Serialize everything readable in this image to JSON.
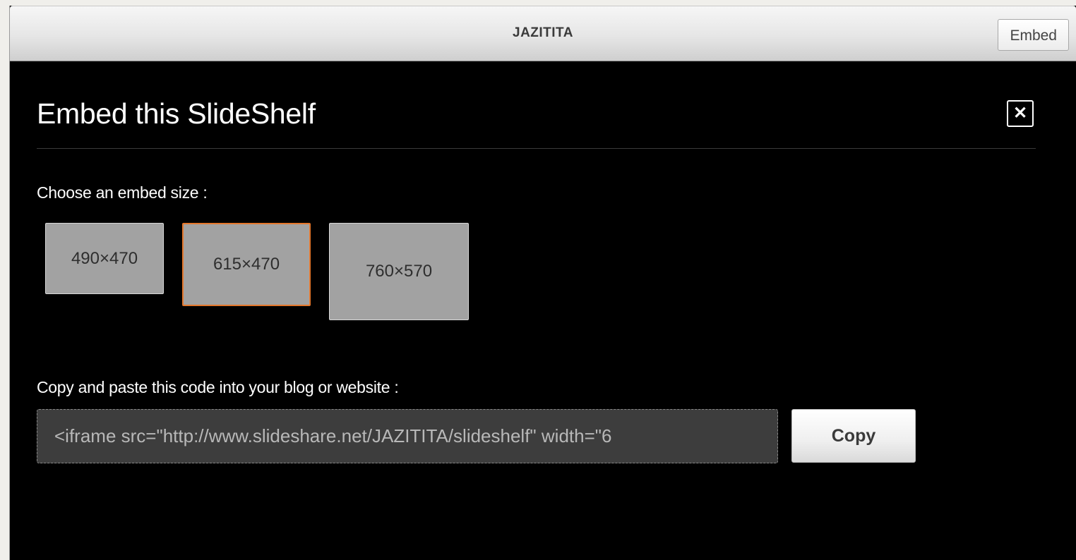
{
  "header": {
    "title": "JAZITITA",
    "embed_button_label": "Embed"
  },
  "dialog": {
    "title": "Embed this SlideShelf",
    "close_icon": "close-icon",
    "size_label": "Choose an embed size :",
    "sizes": [
      {
        "label": "490×470",
        "selected": false
      },
      {
        "label": "615×470",
        "selected": true
      },
      {
        "label": "760×570",
        "selected": false
      }
    ],
    "code_label": "Copy and paste this code into your blog or website :",
    "code_value": "<iframe src=\"http://www.slideshare.net/JAZITITA/slideshelf\" width=\"6",
    "copy_button_label": "Copy"
  },
  "colors": {
    "selected_border": "#e4772c",
    "dialog_background": "#000000",
    "size_option_background": "#a2a2a2"
  }
}
